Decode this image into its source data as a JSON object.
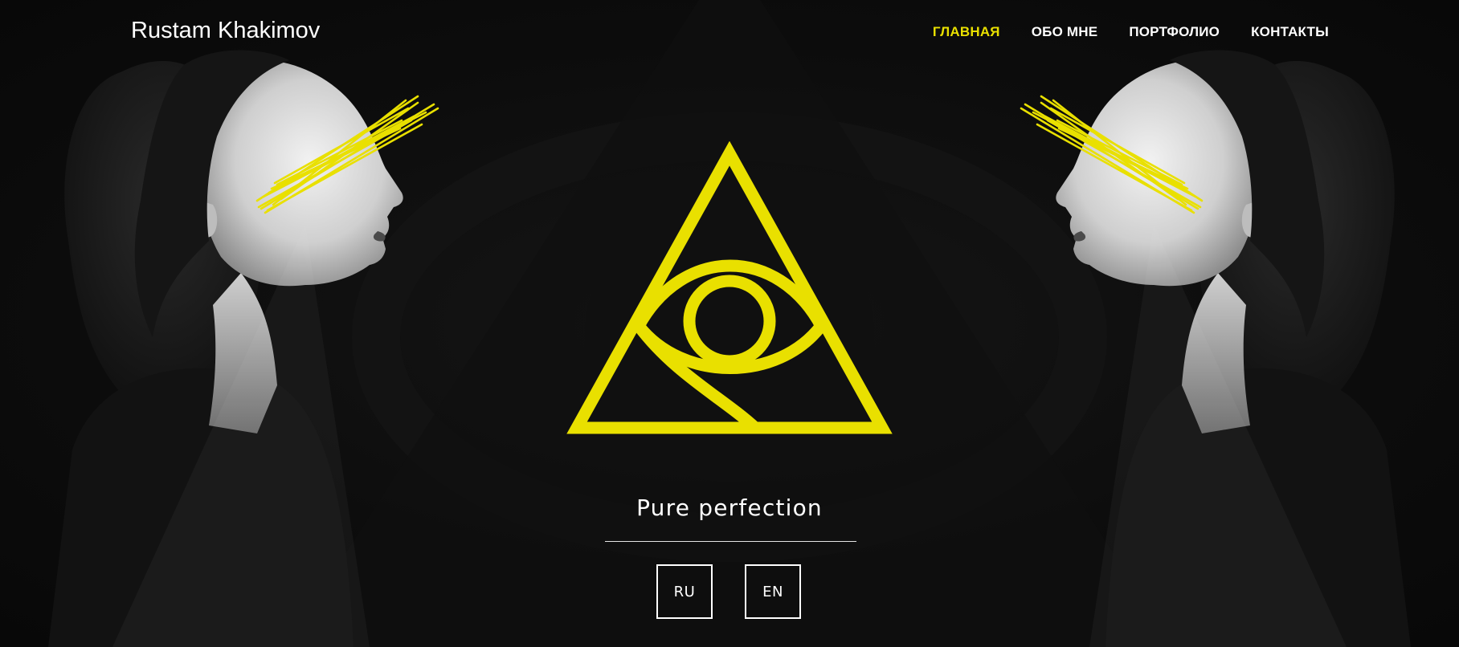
{
  "header": {
    "brand": "Rustam Khakimov",
    "nav": [
      {
        "label": "ГЛАВНАЯ",
        "active": true
      },
      {
        "label": "ОБО МНЕ",
        "active": false
      },
      {
        "label": "ПОРТФОЛИО",
        "active": false
      },
      {
        "label": "КОНТАКТЫ",
        "active": false
      }
    ]
  },
  "hero": {
    "tagline": "Pure perfection",
    "languages": [
      "RU",
      "EN"
    ]
  },
  "colors": {
    "accent": "#e9e000",
    "background": "#0b0b0b",
    "text": "#ffffff"
  },
  "icons": {
    "logo": "eye-of-providence-icon"
  }
}
